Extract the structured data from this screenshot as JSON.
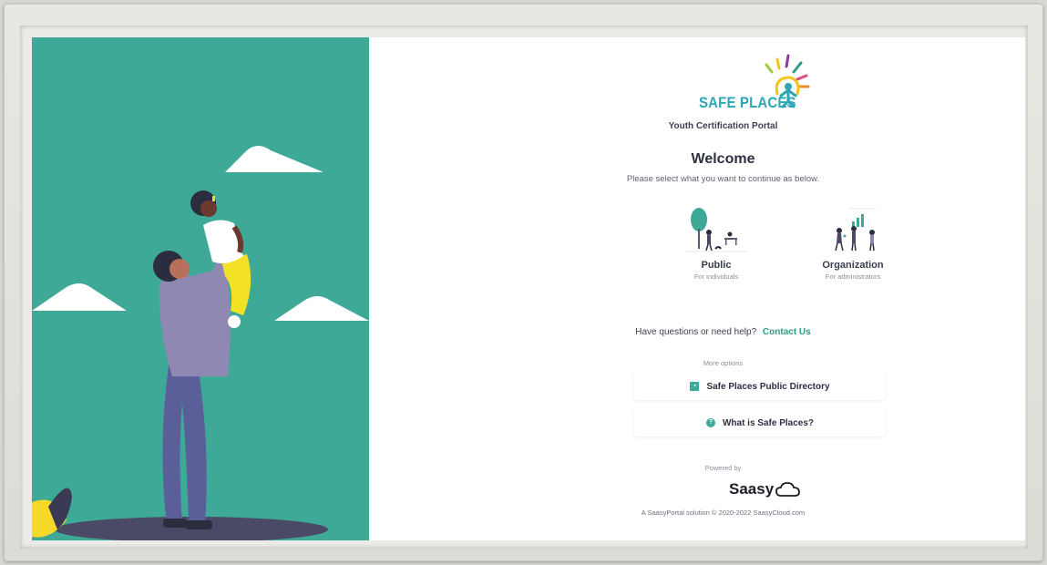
{
  "brand": {
    "logo_text": "SAFE PLACES",
    "portal_title": "Youth Certification Portal"
  },
  "welcome": {
    "heading": "Welcome",
    "instruction": "Please select what you want to continue as below."
  },
  "choices": {
    "public": {
      "title": "Public",
      "subtitle": "For individuals"
    },
    "organization": {
      "title": "Organization",
      "subtitle": "For administrators"
    }
  },
  "help": {
    "question": "Have questions or need help?",
    "contact_link": "Contact Us"
  },
  "more_options": {
    "label": "More options",
    "directory_button": "Safe Places Public Directory",
    "about_button": "What is Safe Places?"
  },
  "footer": {
    "powered_by": "Powered by",
    "vendor": "Saasy",
    "copyright": "A SaasyPortal solution © 2020-2022 SaasyCloud.com"
  },
  "colors": {
    "hero_background": "#3ea996",
    "accent": "#2e9d87",
    "logo_text": "#2ba7b5",
    "heading": "#2d3042"
  },
  "icons": {
    "directory": "contact-book-icon",
    "about": "question-circle-icon",
    "vendor": "cloud-icon"
  }
}
